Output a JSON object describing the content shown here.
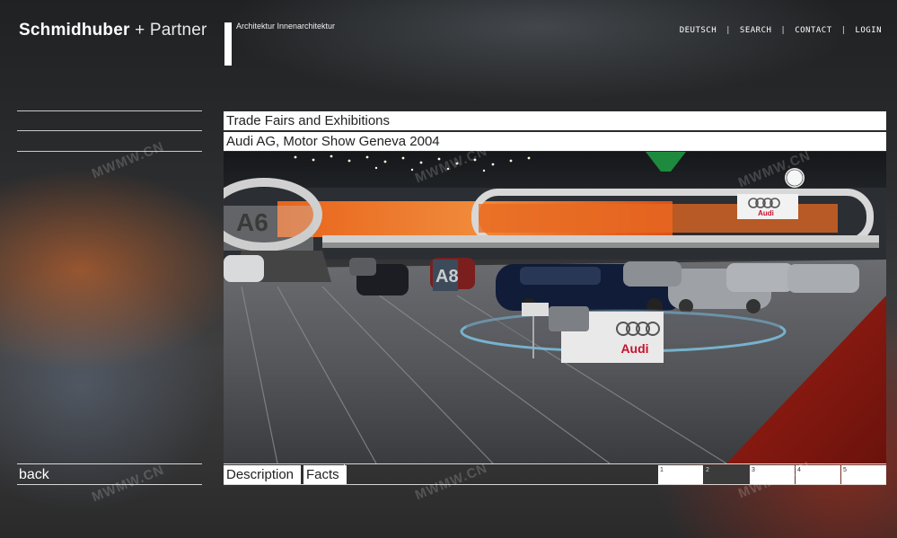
{
  "header": {
    "brand": {
      "strong": "Schmidhuber",
      "plus": " + ",
      "light": "Partner"
    },
    "subtitle": "Architektur  Innenarchitektur",
    "nav": [
      {
        "label": "DEUTSCH"
      },
      {
        "label": "SEARCH"
      },
      {
        "label": "CONTACT"
      },
      {
        "label": "LOGIN"
      }
    ],
    "nav_separator": "|"
  },
  "project": {
    "category": "Trade Fairs and Exhibitions",
    "title": "Audi AG, Motor Show Geneva  2004"
  },
  "photo": {
    "alt": "Audi exhibition stand",
    "signage": [
      "A6",
      "A8",
      "Audi"
    ]
  },
  "footer": {
    "back_label": "back",
    "tabs": [
      {
        "label": "Description"
      },
      {
        "label": "Facts"
      }
    ],
    "pages": [
      {
        "label": "1",
        "active": false
      },
      {
        "label": "2",
        "active": true
      },
      {
        "label": "3",
        "active": false
      },
      {
        "label": "4",
        "active": false
      },
      {
        "label": "5",
        "active": false
      }
    ]
  },
  "watermark": "MWMW.CN",
  "colors": {
    "audi_red": "#c8102e",
    "stand_orange": "#e8641c",
    "active_page": "#3b3b3c"
  }
}
